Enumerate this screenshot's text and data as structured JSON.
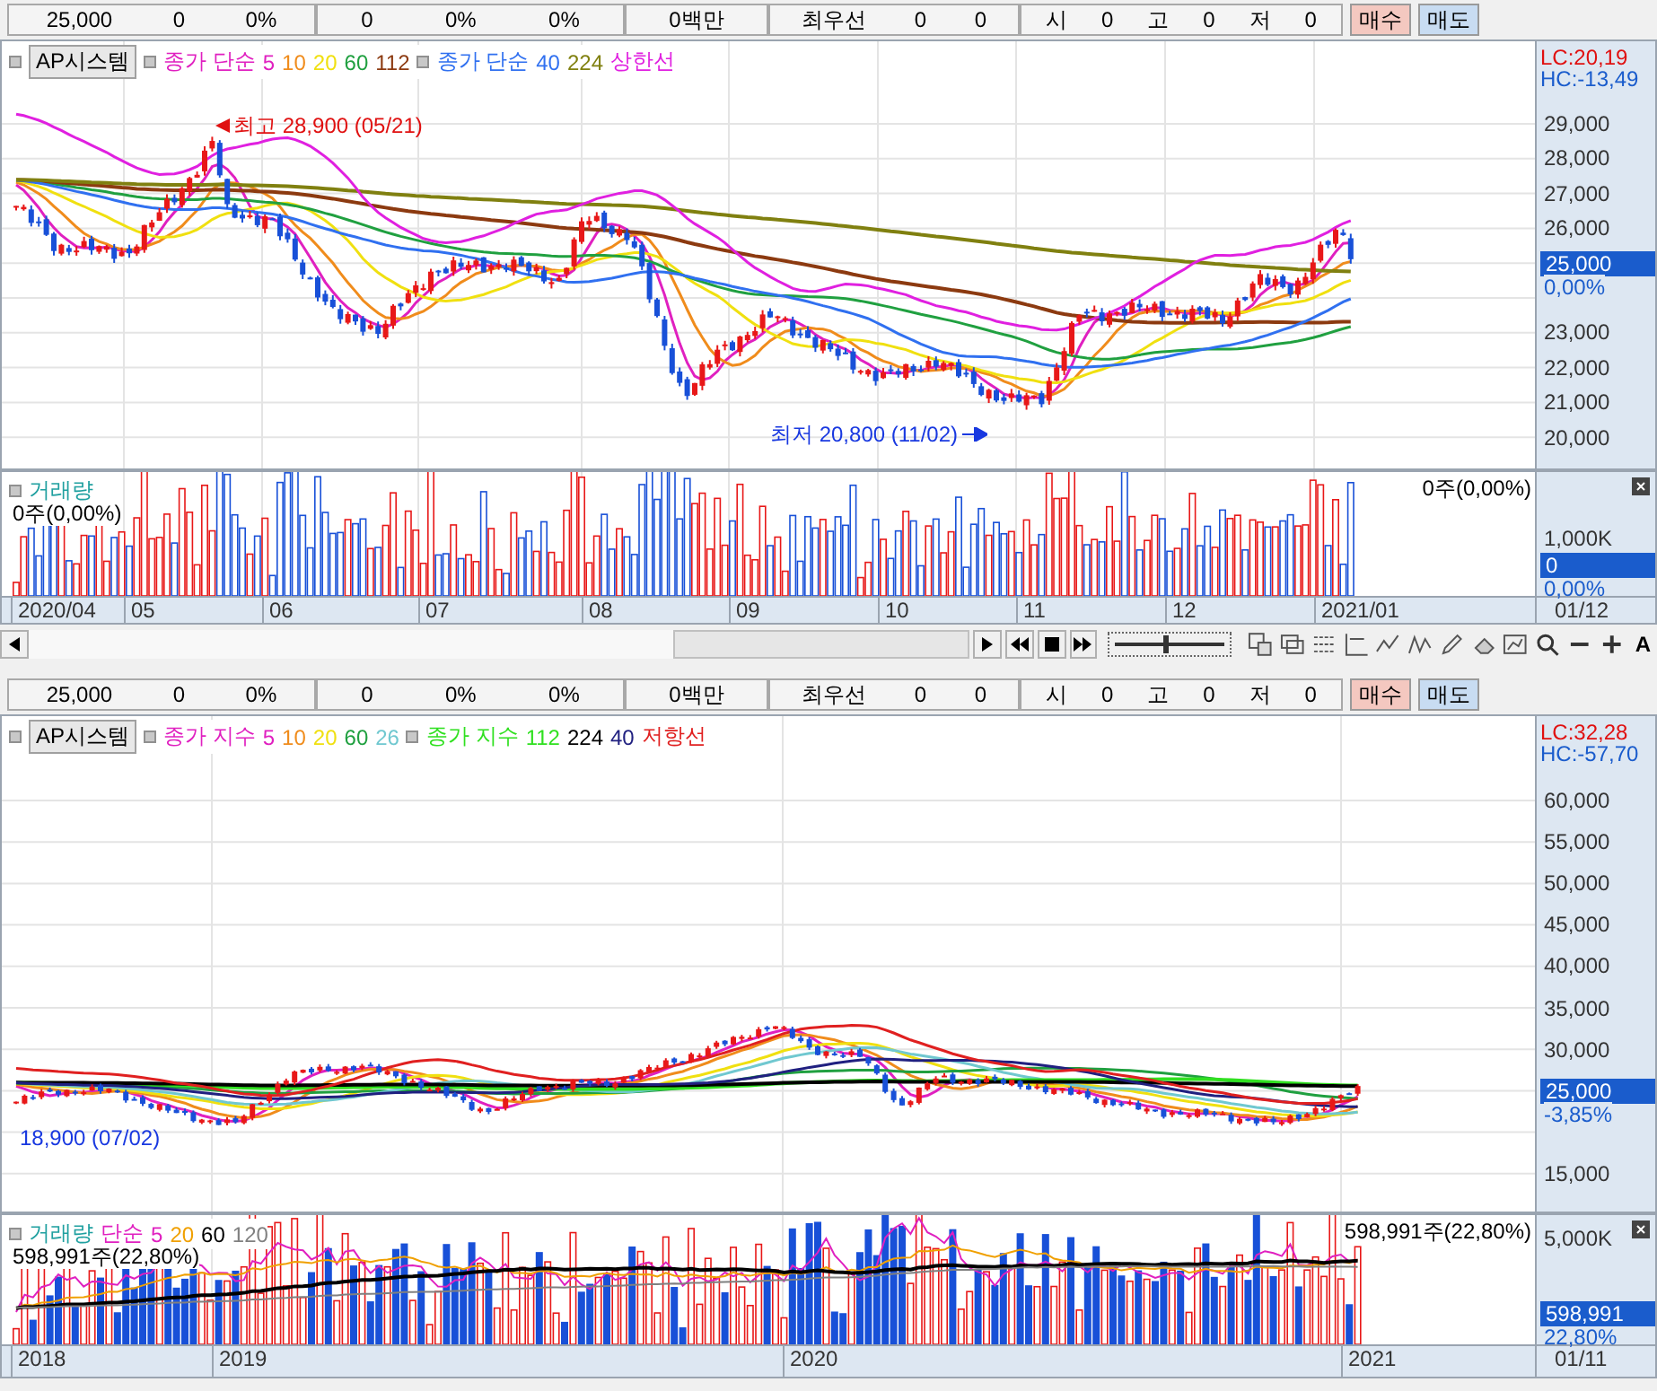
{
  "panels": [
    {
      "kind": "daily",
      "toolbar": {
        "fields": [
          [
            "25,000",
            "0",
            "0%"
          ],
          [
            "0",
            "0%",
            "0%"
          ],
          [
            "0백만"
          ],
          [
            "최우선",
            "0",
            "0"
          ],
          [
            "시",
            "0",
            "고",
            "0",
            "저",
            "0"
          ]
        ],
        "buttons": [
          {
            "label": "매수",
            "kind": "buy"
          },
          {
            "label": "매도",
            "kind": "sell"
          }
        ]
      },
      "legend": {
        "system": "AP시스템",
        "groups": [
          {
            "label": "종가 단순",
            "color": "#e020c0",
            "items": [
              {
                "text": "5",
                "color": "#e020c0"
              },
              {
                "text": "10",
                "color": "#f08c1c"
              },
              {
                "text": "20",
                "color": "#f0e010"
              },
              {
                "text": "60",
                "color": "#20a040"
              },
              {
                "text": "112",
                "color": "#8c3a10"
              }
            ]
          },
          {
            "label": "종가 단순",
            "color": "#3070f0",
            "items": [
              {
                "text": "40",
                "color": "#3070f0"
              },
              {
                "text": "224",
                "color": "#808010"
              },
              {
                "text": "상한선",
                "color": "#e020e0"
              }
            ]
          }
        ]
      },
      "price_axis": {
        "lc": "LC:20,19",
        "hc": "HC:-13,49",
        "ticks": [
          "29,000",
          "28,000",
          "27,000",
          "26,000",
          "23,000",
          "22,000",
          "21,000",
          "20,000"
        ],
        "price": "25,000",
        "change": "0,00%"
      },
      "annotations": [
        {
          "text": "최고 28,900 (05/21)",
          "kind": "high"
        },
        {
          "text": "최저 20,800 (11/02)",
          "kind": "low"
        }
      ],
      "volume": {
        "title": "거래량",
        "value_left": "0주(0,00%)",
        "value_right": "0주(0,00%)",
        "ticks": [
          "1,000K"
        ],
        "current": "0",
        "change": "0,00%"
      },
      "x_axis": {
        "labels": [
          "2020/04",
          "05",
          "06",
          "07",
          "08",
          "09",
          "10",
          "11",
          "12",
          "2021/01"
        ],
        "end": "01/12"
      },
      "tools": {
        "text_button": "A",
        "zoom": {
          "level": 0.45
        }
      }
    },
    {
      "kind": "weekly",
      "toolbar": {
        "fields": [
          [
            "25,000",
            "0",
            "0%"
          ],
          [
            "0",
            "0%",
            "0%"
          ],
          [
            "0백만"
          ],
          [
            "최우선",
            "0",
            "0"
          ],
          [
            "시",
            "0",
            "고",
            "0",
            "저",
            "0"
          ]
        ],
        "buttons": [
          {
            "label": "매수",
            "kind": "buy"
          },
          {
            "label": "매도",
            "kind": "sell"
          }
        ]
      },
      "legend": {
        "system": "AP시스템",
        "groups": [
          {
            "label": "종가 지수",
            "color": "#e020c0",
            "items": [
              {
                "text": "5",
                "color": "#e020c0"
              },
              {
                "text": "10",
                "color": "#f08c1c"
              },
              {
                "text": "20",
                "color": "#f0e010"
              },
              {
                "text": "60",
                "color": "#20a040"
              },
              {
                "text": "26",
                "color": "#70c8d0"
              }
            ]
          },
          {
            "label": "종가 지수",
            "color": "#30e020",
            "items": [
              {
                "text": "112",
                "color": "#30e020"
              },
              {
                "text": "224",
                "color": "#000000"
              },
              {
                "text": "40",
                "color": "#202080"
              },
              {
                "text": "저항선",
                "color": "#e02020"
              }
            ]
          }
        ]
      },
      "price_axis": {
        "lc": "LC:32,28",
        "hc": "HC:-57,70",
        "ticks": [
          "60,000",
          "55,000",
          "50,000",
          "45,000",
          "40,000",
          "35,000",
          "30,000",
          "15,000"
        ],
        "price": "25,000",
        "change": "-3,85%"
      },
      "annotations": [
        {
          "text": "18,900 (07/02)",
          "kind": "mark"
        }
      ],
      "volume": {
        "title": "거래량",
        "groups": [
          {
            "label": "단순",
            "color": "#e020c0",
            "items": [
              {
                "text": "5",
                "color": "#e020c0"
              },
              {
                "text": "20",
                "color": "#f0a000"
              },
              {
                "text": "60",
                "color": "#000000"
              },
              {
                "text": "120",
                "color": "#808080"
              }
            ]
          }
        ],
        "value_left": "598,991주(22,80%)",
        "value_right": "598,991주(22,80%)",
        "ticks": [
          "5,000K"
        ],
        "current": "598,991",
        "change": "22,80%"
      },
      "x_axis": {
        "labels": [
          "2018",
          "2019",
          "2020",
          "2021"
        ],
        "end": "01/11"
      }
    }
  ]
}
